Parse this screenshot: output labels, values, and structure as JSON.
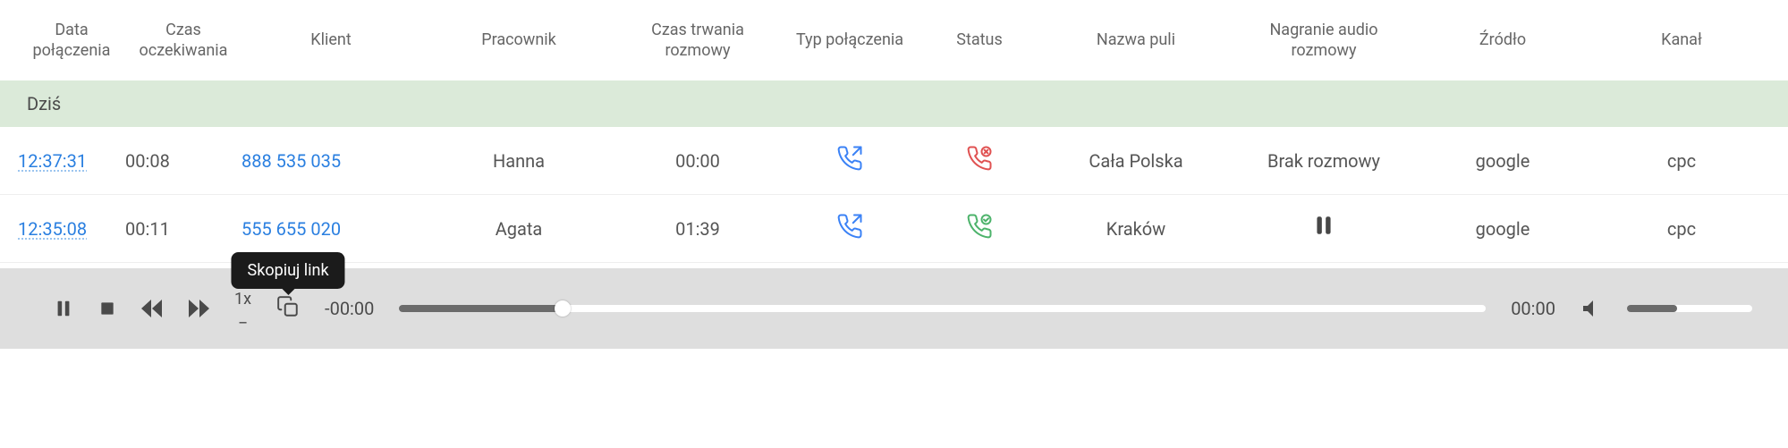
{
  "columns": {
    "date": "Data połączenia",
    "wait": "Czas oczekiwania",
    "client": "Klient",
    "employee": "Pracownik",
    "duration": "Czas trwania rozmowy",
    "callType": "Typ połączenia",
    "status": "Status",
    "pool": "Nazwa puli",
    "recording": "Nagranie audio rozmowy",
    "source": "Źródło",
    "channel": "Kanał"
  },
  "group": {
    "label": "Dziś"
  },
  "rows": [
    {
      "time": "12:37:31",
      "wait": "00:08",
      "client": "888 535 035",
      "employee": "Hanna",
      "duration": "00:00",
      "callType": "outgoing",
      "status": "missed",
      "pool": "Cała Polska",
      "recording": "Brak rozmowy",
      "source": "google",
      "channel": "cpc"
    },
    {
      "time": "12:35:08",
      "wait": "00:11",
      "client": "555 655 020",
      "employee": "Agata",
      "duration": "01:39",
      "callType": "outgoing",
      "status": "answered",
      "pool": "Kraków",
      "recording": "playable",
      "source": "google",
      "channel": "cpc"
    }
  ],
  "player": {
    "speed": "1x",
    "copyTooltip": "Skopiuj link",
    "elapsed": "-00:00",
    "remaining": "00:00"
  }
}
